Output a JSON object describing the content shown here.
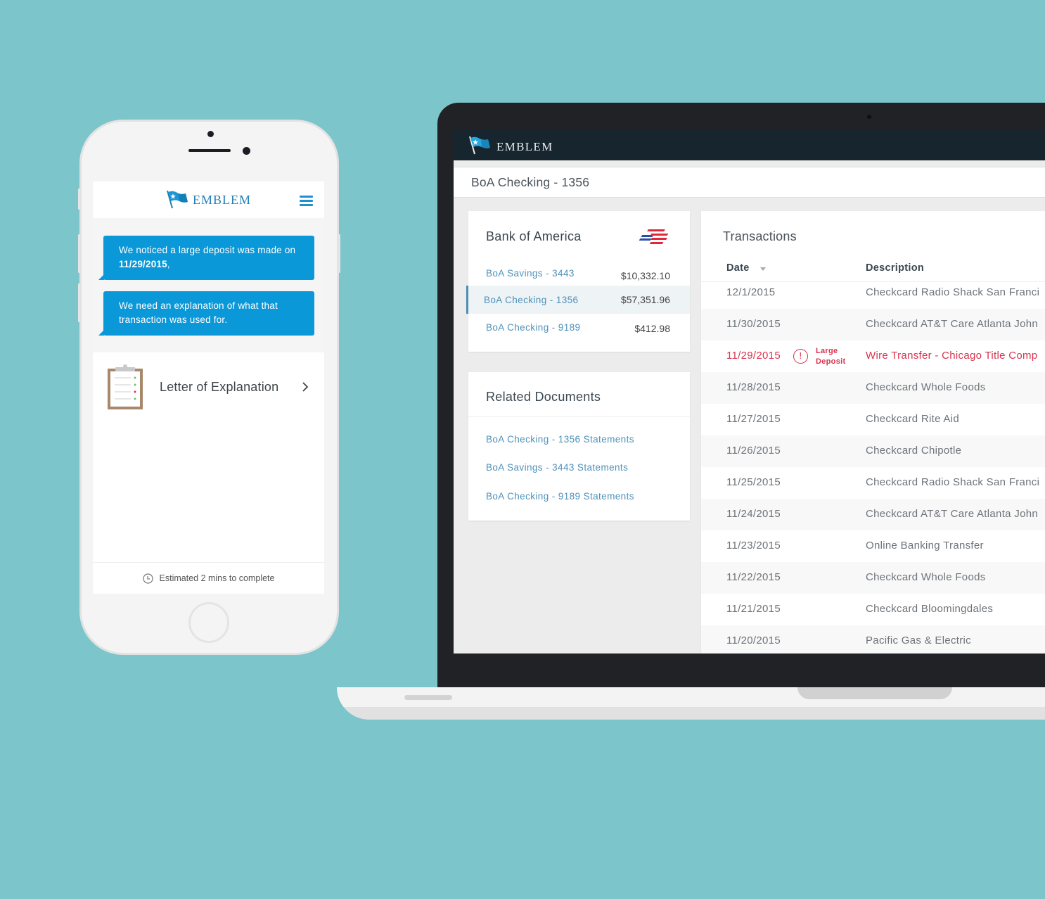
{
  "phone": {
    "brand": "EMBLEM",
    "messages": [
      {
        "text_before": "We noticed a large deposit was made on ",
        "bold": "11/29/2015",
        "text_after": ","
      },
      {
        "text": "We need an explanation of what that transaction was used for."
      }
    ],
    "task": {
      "title": "Letter of Explanation",
      "estimate": "Estimated 2 mins to complete"
    }
  },
  "laptop": {
    "brand": "EMBLEM",
    "page_title": "BoA Checking - 1356",
    "bank": {
      "name": "Bank of America",
      "accounts": [
        {
          "name": "BoA Savings - 3443",
          "balance": "$10,332.10",
          "selected": false
        },
        {
          "name": "BoA Checking - 1356",
          "balance": "$57,351.96",
          "selected": true
        },
        {
          "name": "BoA Checking - 9189",
          "balance": "$412.98",
          "selected": false
        }
      ]
    },
    "related_documents": {
      "title": "Related Documents",
      "links": [
        "BoA Checking - 1356 Statements",
        "BoA Savings - 3443 Statements",
        "BoA Checking - 9189 Statements"
      ]
    },
    "transactions": {
      "title": "Transactions",
      "columns": {
        "date": "Date",
        "description": "Description"
      },
      "flag_label_line1": "Large",
      "flag_label_line2": "Deposit",
      "flag_icon": "!",
      "rows": [
        {
          "date": "12/1/2015",
          "description": "Checkcard Radio Shack San Franci",
          "flagged": false
        },
        {
          "date": "11/30/2015",
          "description": "Checkcard AT&T Care Atlanta John",
          "flagged": false
        },
        {
          "date": "11/29/2015",
          "description": "Wire Transfer - Chicago Title Comp",
          "flagged": true
        },
        {
          "date": "11/28/2015",
          "description": "Checkcard Whole Foods",
          "flagged": false
        },
        {
          "date": "11/27/2015",
          "description": "Checkcard Rite Aid",
          "flagged": false
        },
        {
          "date": "11/26/2015",
          "description": "Checkcard Chipotle",
          "flagged": false
        },
        {
          "date": "11/25/2015",
          "description": "Checkcard Radio Shack San Franci",
          "flagged": false
        },
        {
          "date": "11/24/2015",
          "description": "Checkcard AT&T Care Atlanta John",
          "flagged": false
        },
        {
          "date": "11/23/2015",
          "description": "Online Banking Transfer",
          "flagged": false
        },
        {
          "date": "11/22/2015",
          "description": "Checkcard Whole Foods",
          "flagged": false
        },
        {
          "date": "11/21/2015",
          "description": "Checkcard Bloomingdales",
          "flagged": false
        },
        {
          "date": "11/20/2015",
          "description": "Pacific Gas & Electric",
          "flagged": false
        }
      ]
    }
  },
  "colors": {
    "background": "#7cc5cb",
    "brand_blue": "#0a98d9",
    "link_blue": "#4f91b9",
    "alert_red": "#d9334f",
    "topbar": "#17252e"
  }
}
